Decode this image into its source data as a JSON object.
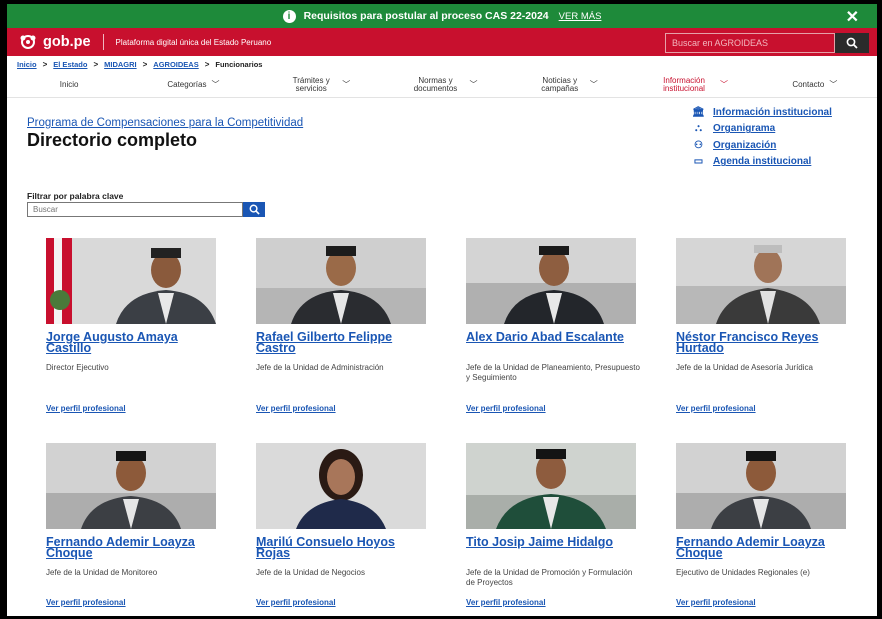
{
  "banner": {
    "icon": "info-icon",
    "text": "Requisitos para postular al proceso CAS 22-2024",
    "link": "VER MÁS",
    "close_icon": "close-icon"
  },
  "header": {
    "logo_text": "gob.pe",
    "tagline": "Plataforma digital única del Estado Peruano",
    "search_placeholder": "Buscar en AGROIDEAS",
    "brand_color": "#c8102e"
  },
  "breadcrumb": [
    "Inicio",
    "El Estado",
    "MIDAGRI",
    "AGROIDEAS",
    "Funcionarios"
  ],
  "nav": [
    {
      "label": "Inicio"
    },
    {
      "label": "Categorías"
    },
    {
      "label": "Trámites y servicios"
    },
    {
      "label": "Normas y documentos"
    },
    {
      "label": "Noticias y campañas"
    },
    {
      "label": "Información institucional"
    },
    {
      "label": "Contacto"
    }
  ],
  "page": {
    "program": "Programa de Compensaciones para la Competitividad",
    "title": "Directorio completo",
    "filter_label": "Filtrar por palabra clave",
    "filter_placeholder": "Buscar"
  },
  "side_links": [
    {
      "icon": "institution-icon",
      "label": "Información institucional"
    },
    {
      "icon": "org-chart-icon",
      "label": "Organigrama"
    },
    {
      "icon": "people-icon",
      "label": "Organización"
    },
    {
      "icon": "calendar-icon",
      "label": "Agenda institucional"
    }
  ],
  "officials": [
    {
      "name": "Jorge Augusto Amaya Castillo",
      "role": "Director Ejecutivo",
      "link": "Ver perfil profesional"
    },
    {
      "name": "Rafael Gilberto Felippe Castro",
      "role": "Jefe de la Unidad de Administración",
      "link": "Ver perfil profesional"
    },
    {
      "name": "Alex Dario Abad Escalante",
      "role": "Jefe de la Unidad de Planeamiento, Presupuesto y Seguimiento",
      "link": "Ver perfil profesional"
    },
    {
      "name": "Néstor Francisco Reyes Hurtado",
      "role": "Jefe de la Unidad de Asesoría Jurídica",
      "link": "Ver perfil profesional"
    },
    {
      "name": "Fernando Ademir Loayza Choque",
      "role": "Jefe de la Unidad de Monitoreo",
      "link": "Ver perfil profesional"
    },
    {
      "name": "Marilú Consuelo Hoyos Rojas",
      "role": "Jefe de la Unidad de Negocios",
      "link": "Ver perfil profesional"
    },
    {
      "name": "Tito Josip Jaime Hidalgo",
      "role": "Jefe de la Unidad de Promoción y Formulación de Proyectos",
      "link": "Ver perfil profesional"
    },
    {
      "name": "Fernando Ademir Loayza Choque",
      "role": "Ejecutivo de Unidades Regionales (e)",
      "link": "Ver perfil profesional"
    }
  ]
}
